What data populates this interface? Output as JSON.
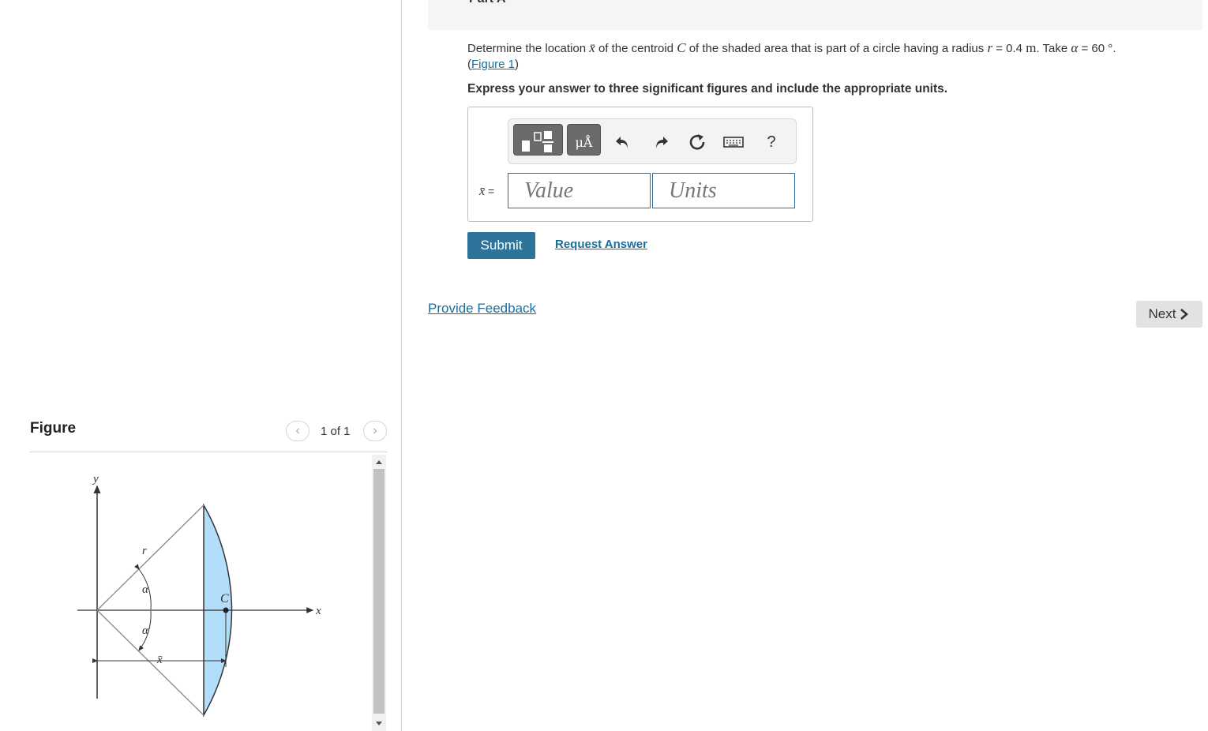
{
  "part": {
    "label": "Part A"
  },
  "question": {
    "t1": "Determine the location ",
    "xbar": "x̄",
    "t2": " of the centroid ",
    "c": "C",
    "t3": " of the shaded area that is part of a circle having a radius ",
    "r": "r",
    "t4": " = 0.4 ",
    "m": "m",
    "t5": ". Take ",
    "alpha": "α",
    "t6": " = 60 °.",
    "paren_open": "(",
    "figure_link": "Figure 1",
    "paren_close": ")"
  },
  "instructions": "Express your answer to three significant figures and include the appropriate units.",
  "answer": {
    "label_var": "x̄",
    "label_eq": " =",
    "value_placeholder": "Value",
    "units_placeholder": "Units",
    "units_button": "μÅ",
    "help": "?"
  },
  "buttons": {
    "submit": "Submit",
    "request_answer": "Request Answer",
    "provide_feedback": "Provide Feedback",
    "next": "Next"
  },
  "figure": {
    "title": "Figure",
    "count": "1 of 1",
    "labels": {
      "y": "y",
      "x": "x",
      "r": "r",
      "alpha_top": "α",
      "alpha_bottom": "α",
      "c": "C",
      "xbar": "x̄"
    },
    "fill_color": "#b3def9"
  },
  "colors": {
    "accent": "#2e7399",
    "link": "#1a6e9a"
  }
}
